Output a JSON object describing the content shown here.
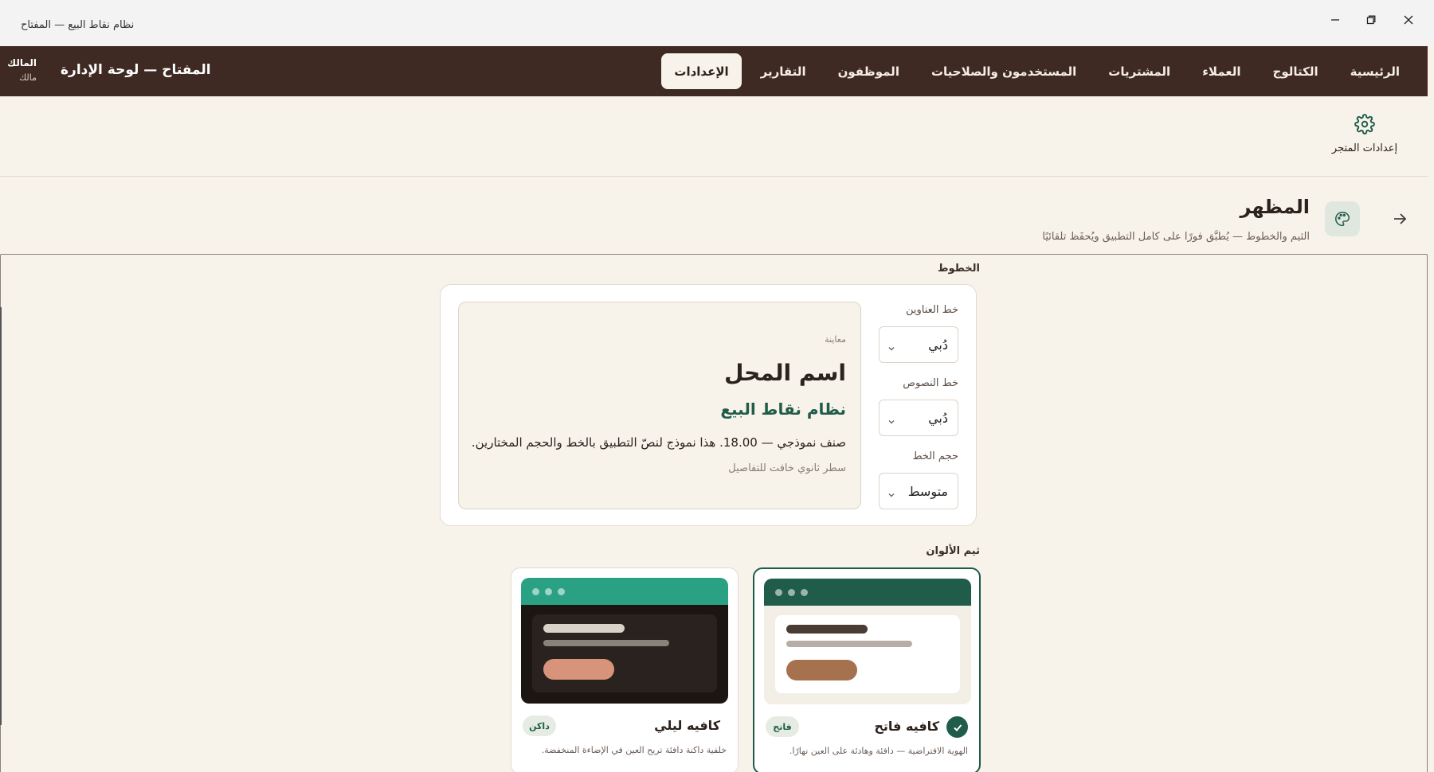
{
  "window": {
    "title": "نظام نقاط البيع — المفتاح"
  },
  "header": {
    "brand": "المفتاح — لوحة الإدارة",
    "user": {
      "name": "المالك",
      "role": "مالك"
    },
    "nav": [
      {
        "label": "الرئيسية"
      },
      {
        "label": "الكتالوج"
      },
      {
        "label": "العملاء"
      },
      {
        "label": "المشتريات"
      },
      {
        "label": "المستخدمون والصلاحيات"
      },
      {
        "label": "الموظفون"
      },
      {
        "label": "التقارير"
      },
      {
        "label": "الإعدادات",
        "active": true
      }
    ]
  },
  "subnav": {
    "store_settings": "إعدادات المتجر",
    "icon": "gear-icon"
  },
  "section": {
    "title": "المظهر",
    "subtitle": "الثيم والخطوط — يُطبَّق فورًا على كامل التطبيق ويُحفَظ تلقائيًا",
    "icon": "palette-icon"
  },
  "fonts": {
    "group_label": "الخطوط",
    "heading_font": {
      "label": "خط العناوين",
      "value": "دُبي"
    },
    "body_font": {
      "label": "خط النصوص",
      "value": "دُبي"
    },
    "font_size": {
      "label": "حجم الخط",
      "value": "متوسط"
    },
    "preview": {
      "caption": "معاينة",
      "store_name": "اسم المحل",
      "pos_title": "نظام نقاط البيع",
      "body_sample": "صنف نموذجي — 18.00. هذا نموذج لنصّ التطبيق بالخط والحجم المختارين.",
      "secondary": "سطر ثانوي خافت للتفاصيل"
    }
  },
  "themes": {
    "group_label": "ثيم الألوان",
    "items": [
      {
        "name": "كافيه فاتح",
        "badge": "فاتح",
        "description": "الهوية الافتراضية — دافئة وهادئة على العين نهارًا.",
        "selected": true,
        "colors": {
          "bar": "#1f5c4a",
          "body": "#f3eee6",
          "inner": "#ffffff",
          "line1": "#4a3b35",
          "line2": "#b8ada6",
          "pill": "#a6714e"
        }
      },
      {
        "name": "كافيه ليلي",
        "badge": "داكن",
        "description": "خلفية داكنة دافئة تريح العين في الإضاءة المنخفضة.",
        "selected": false,
        "colors": {
          "bar": "#2aa183",
          "body": "#1c1613",
          "inner": "#2a221e",
          "line1": "#d9d2cb",
          "line2": "#8a817b",
          "pill": "#d8937b"
        }
      }
    ]
  },
  "colors": {
    "accent": "#1f5c4a",
    "header_bg": "#3e2a23",
    "page_bg": "#f7f2ea"
  }
}
